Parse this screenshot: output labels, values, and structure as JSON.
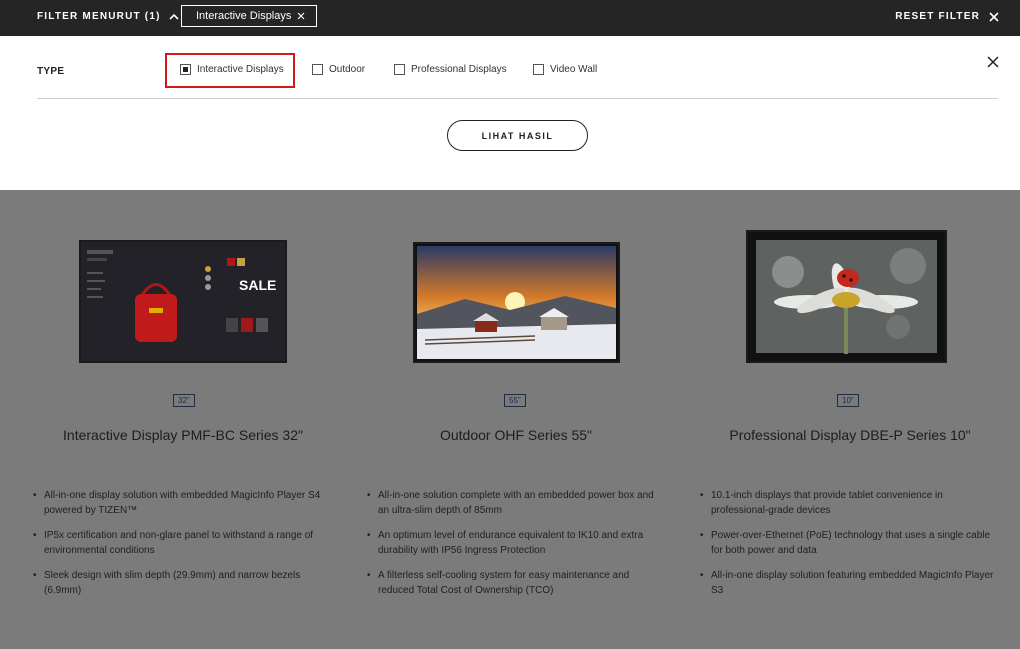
{
  "filter_bar": {
    "toggle_label": "FILTER MENURUT (1)",
    "active_chip": "Interactive Displays",
    "reset_label": "RESET FILTER"
  },
  "filter_panel": {
    "type_label": "TYPE",
    "options": [
      {
        "label": "Interactive Displays",
        "checked": true
      },
      {
        "label": "Outdoor",
        "checked": false
      },
      {
        "label": "Professional Displays",
        "checked": false
      },
      {
        "label": "Video Wall",
        "checked": false
      }
    ],
    "cta_label": "LIHAT HASIL"
  },
  "products": [
    {
      "size": "32\"",
      "title": "Interactive Display PMF-BC Series 32\"",
      "features": [
        "All-in-one display solution with embedded MagicInfo Player S4 powered by TIZEN™",
        "IP5x certification and non-glare panel to withstand a range of environmental conditions",
        "Sleek design with slim depth (29.9mm) and narrow bezels (6.9mm)"
      ],
      "screen_text": "SALE"
    },
    {
      "size": "55\"",
      "title": "Outdoor OHF Series 55\"",
      "features": [
        "All-in-one solution complete with an embedded power box and an ultra-slim depth of 85mm",
        "An optimum level of endurance equivalent to IK10 and extra durability with IP56 Ingress Protection",
        "A filterless self-cooling system for easy maintenance and reduced Total Cost of Ownership (TCO)"
      ]
    },
    {
      "size": "10\"",
      "title": "Professional Display DBE-P Series 10\"",
      "features": [
        "10.1-inch displays that provide tablet convenience in professional-grade devices",
        "Power-over-Ethernet (PoE) technology that uses a single cable for both power and data",
        "All-in-one display solution featuring embedded MagicInfo Player S3"
      ]
    }
  ]
}
